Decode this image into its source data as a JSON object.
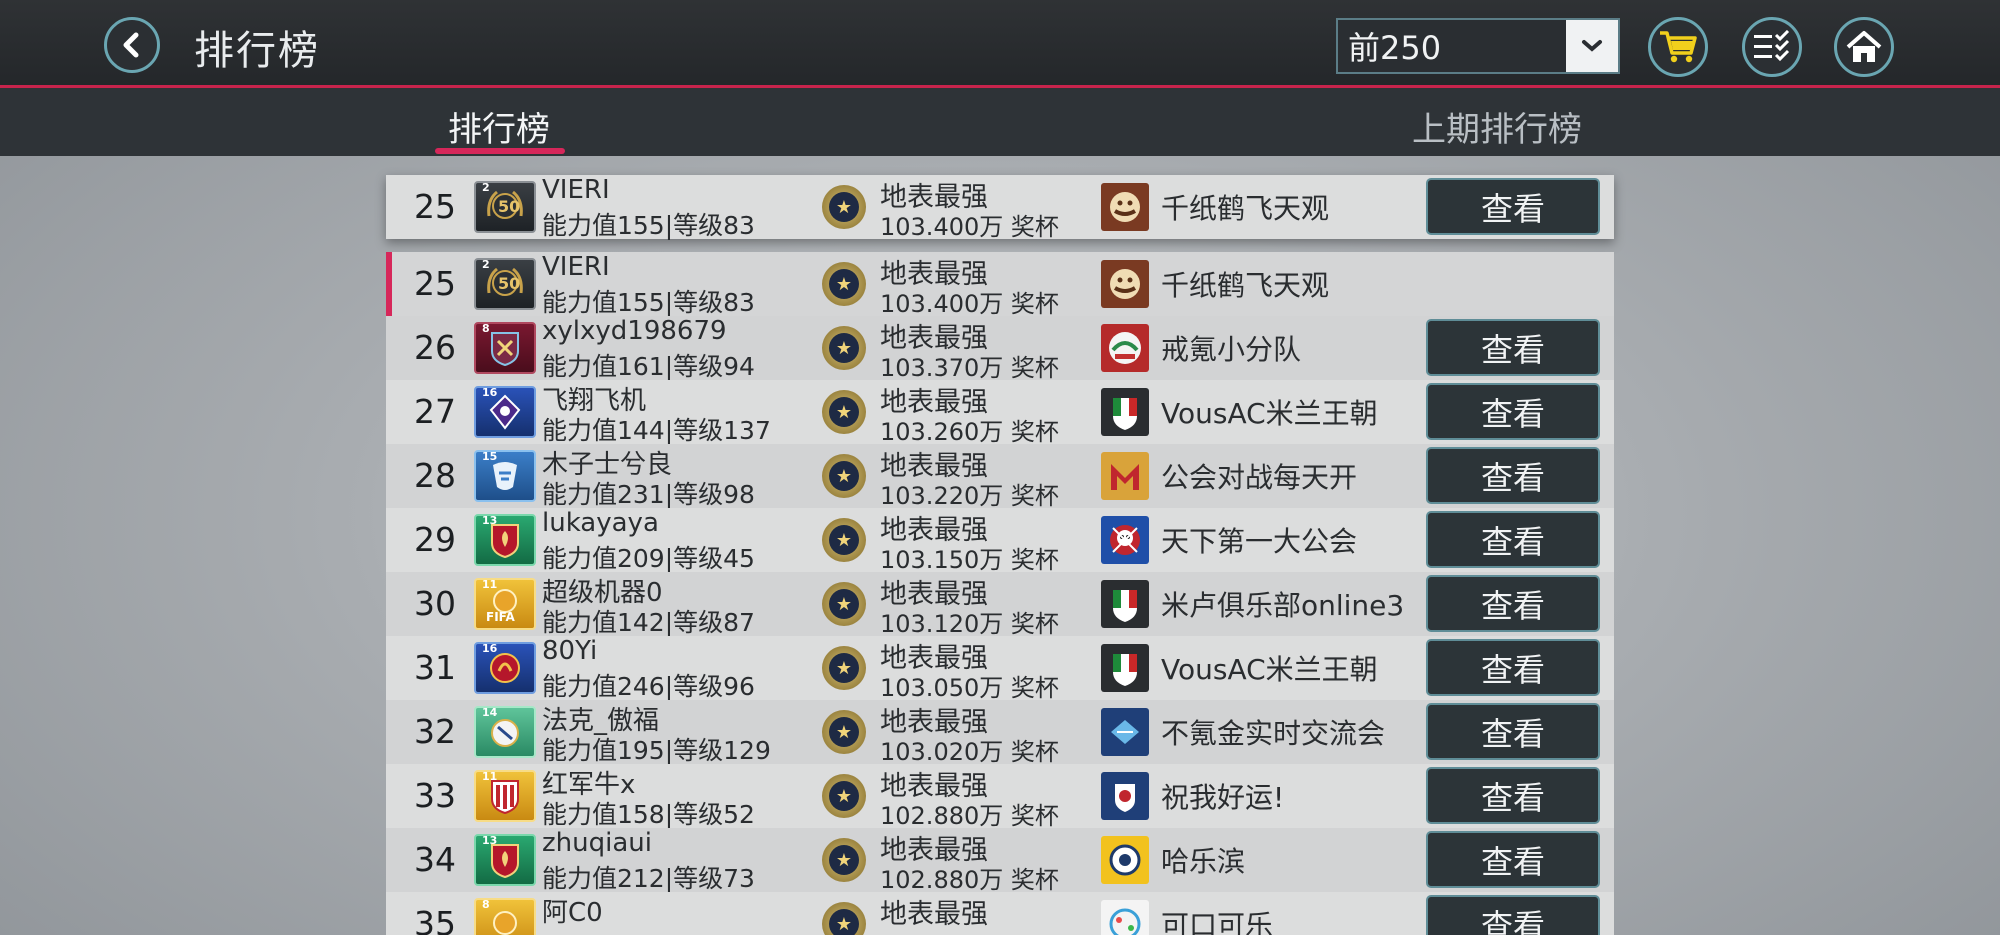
{
  "header": {
    "title": "排行榜",
    "range_select": "前250",
    "icons": {
      "back": "back-arrow-icon",
      "cart": "shopping-cart-icon",
      "checklist": "checklist-icon",
      "home": "home-icon"
    }
  },
  "tabs": [
    {
      "label": "排行榜",
      "active": true
    },
    {
      "label": "上期排行榜",
      "active": false
    }
  ],
  "view_label": "查看",
  "pinned_row": {
    "rank": "25",
    "badge_level": "2",
    "badge_text": "50",
    "name": "VIERI",
    "stats": "能力值155|等级83",
    "tier": "地表最强",
    "score": "103.400万 奖杯",
    "guild": "千纸鹤飞天观"
  },
  "rows": [
    {
      "rank": "25",
      "badge_level": "2",
      "badge_text": "50",
      "name": "VIERI",
      "stats": "能力值155|等级83",
      "tier": "地表最强",
      "score": "103.400万 奖杯",
      "guild": "千纸鹤飞天观",
      "self": true
    },
    {
      "rank": "26",
      "badge_level": "8",
      "badge_text": "",
      "name": "xylxyd198679",
      "stats": "能力值161|等级94",
      "tier": "地表最强",
      "score": "103.370万 奖杯",
      "guild": "戒氪小分队"
    },
    {
      "rank": "27",
      "badge_level": "16",
      "badge_text": "",
      "name": "飞翔飞机",
      "stats": "能力值144|等级137",
      "tier": "地表最强",
      "score": "103.260万 奖杯",
      "guild": "VousAC米兰王朝"
    },
    {
      "rank": "28",
      "badge_level": "15",
      "badge_text": "",
      "name": "木子士兮良",
      "stats": "能力值231|等级98",
      "tier": "地表最强",
      "score": "103.220万 奖杯",
      "guild": "公会对战每天开"
    },
    {
      "rank": "29",
      "badge_level": "13",
      "badge_text": "",
      "name": "lukayaya",
      "stats": "能力值209|等级45",
      "tier": "地表最强",
      "score": "103.150万 奖杯",
      "guild": "天下第一大公会"
    },
    {
      "rank": "30",
      "badge_level": "11",
      "badge_text": "FIFA",
      "name": "超级机器0",
      "stats": "能力值142|等级87",
      "tier": "地表最强",
      "score": "103.120万 奖杯",
      "guild": "米卢俱乐部online3"
    },
    {
      "rank": "31",
      "badge_level": "16",
      "badge_text": "",
      "name": "80Yi",
      "stats": "能力值246|等级96",
      "tier": "地表最强",
      "score": "103.050万 奖杯",
      "guild": "VousAC米兰王朝"
    },
    {
      "rank": "32",
      "badge_level": "14",
      "badge_text": "",
      "name": "法克_傲福",
      "stats": "能力值195|等级129",
      "tier": "地表最强",
      "score": "103.020万 奖杯",
      "guild": "不氪金实时交流会"
    },
    {
      "rank": "33",
      "badge_level": "11",
      "badge_text": "",
      "name": "红军牛x",
      "stats": "能力值158|等级52",
      "tier": "地表最强",
      "score": "102.880万 奖杯",
      "guild": "祝我好运!"
    },
    {
      "rank": "34",
      "badge_level": "13",
      "badge_text": "",
      "name": "zhuqiaui",
      "stats": "能力值212|等级73",
      "tier": "地表最强",
      "score": "102.880万 奖杯",
      "guild": "哈乐滨"
    },
    {
      "rank": "35",
      "badge_level": "8",
      "badge_text": "",
      "name": "阿C0",
      "stats": "",
      "tier": "地表最强",
      "score": "",
      "guild": "可口可乐"
    }
  ],
  "colors": {
    "accent": "#d6275a",
    "button_bg": "#2c3438",
    "button_border": "#5f8d97"
  }
}
